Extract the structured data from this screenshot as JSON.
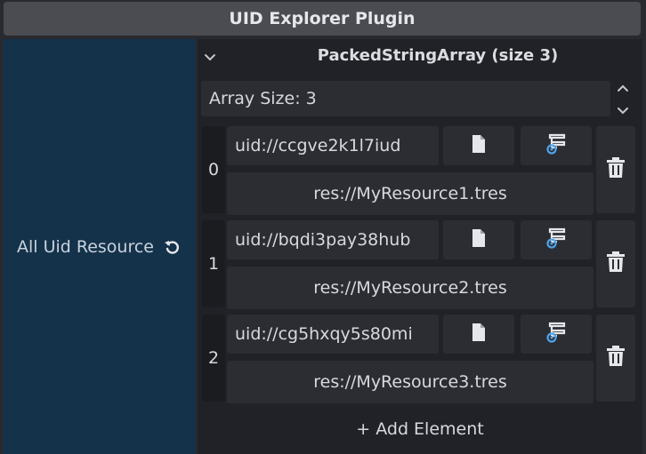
{
  "window": {
    "title": "UID Explorer Plugin"
  },
  "sidebar": {
    "label": "All Uid Resource",
    "icon": "revert-icon"
  },
  "array": {
    "header": "PackedStringArray (size 3)",
    "size_label": "Array Size: 3",
    "add_label": "+ Add Element",
    "elements": [
      {
        "index": "0",
        "uid": "uid://ccgve2k1l7iud",
        "path": "res://MyResource1.tres"
      },
      {
        "index": "1",
        "uid": "uid://bqdi3pay38hub",
        "path": "res://MyResource2.tres"
      },
      {
        "index": "2",
        "uid": "uid://cg5hxqy5s80mi",
        "path": "res://MyResource3.tres"
      }
    ]
  },
  "colors": {
    "accent": "#4fa3e8",
    "sidebar_bg": "#15324b",
    "panel_bg": "#212227"
  }
}
